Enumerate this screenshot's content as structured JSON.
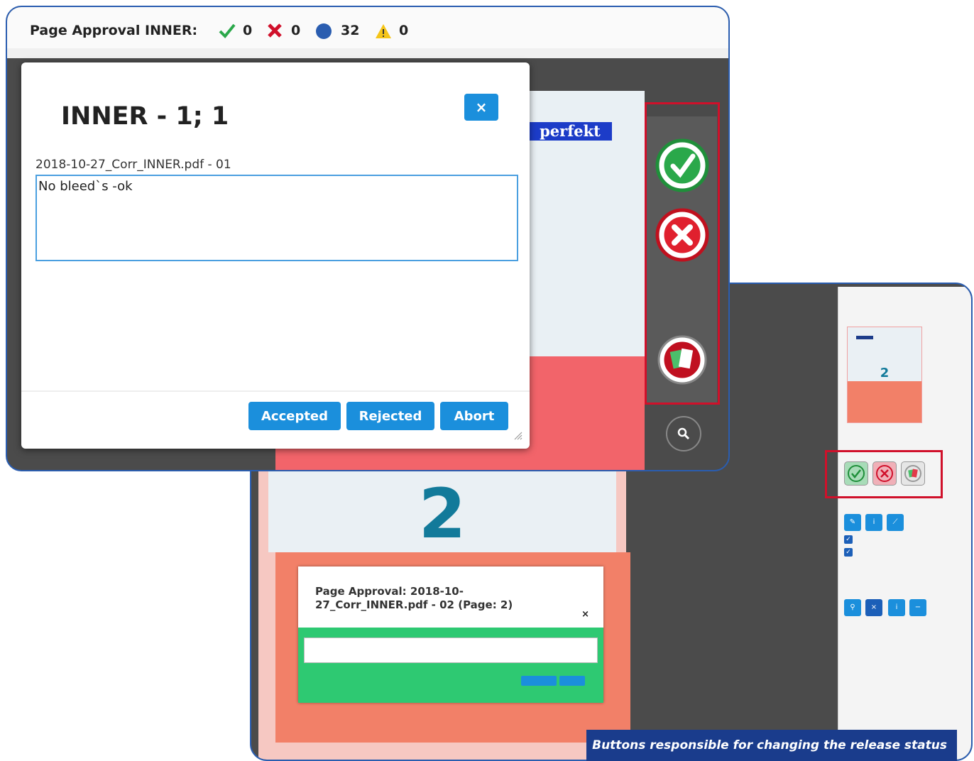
{
  "header": {
    "title": "Page Approval INNER:",
    "accepted_count": "0",
    "rejected_count": "0",
    "pending_count": "32",
    "warning_count": "0"
  },
  "logo_text": "perfekt",
  "modal": {
    "title": "INNER - 1; 1",
    "close_label": "×",
    "file_label": "2018-10-27_Corr_INNER.pdf - 01",
    "comment": "No bleed`s -ok",
    "buttons": {
      "accepted": "Accepted",
      "rejected": "Rejected",
      "abort": "Abort"
    }
  },
  "back_window": {
    "page_number": "2",
    "mini_dialog_title": "Page Approval: 2018-10-27_Corr_INNER.pdf - 02 (Page: 2)",
    "mini_close": "×",
    "tools_panel": {
      "thumb_number": "2"
    }
  },
  "caption": "Buttons responsible for changing the release status",
  "colors": {
    "accept_green": "#1f8f3a",
    "reject_red": "#d0102a",
    "pending_blue": "#2a5db0",
    "button_blue": "#1b8fdc",
    "highlight_red": "#d0102a"
  }
}
